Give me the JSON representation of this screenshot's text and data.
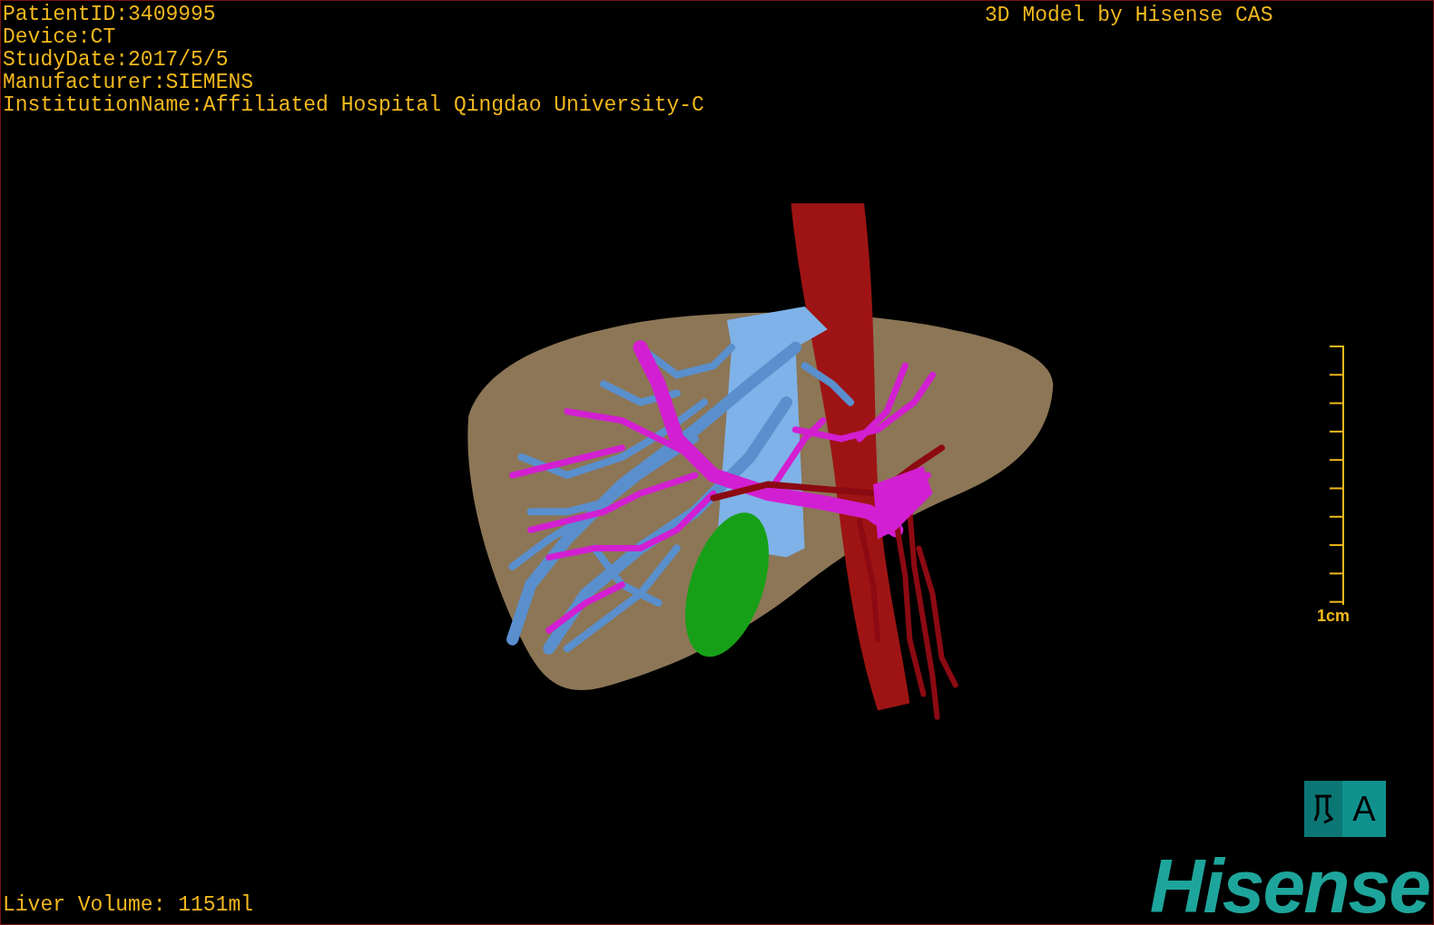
{
  "info_lines": [
    "PatientID:3409995",
    "Device:CT",
    "StudyDate:2017/5/5",
    "Manufacturer:SIEMENS",
    "InstitutionName:Affiliated Hospital Qingdao University-C"
  ],
  "title": "3D Model by Hisense CAS",
  "scale_bar": {
    "label": "1cm"
  },
  "orientation_cube": {
    "label": "A"
  },
  "liver_volume": "Liver Volume: 1151ml",
  "logo": {
    "text": "Hisense"
  }
}
